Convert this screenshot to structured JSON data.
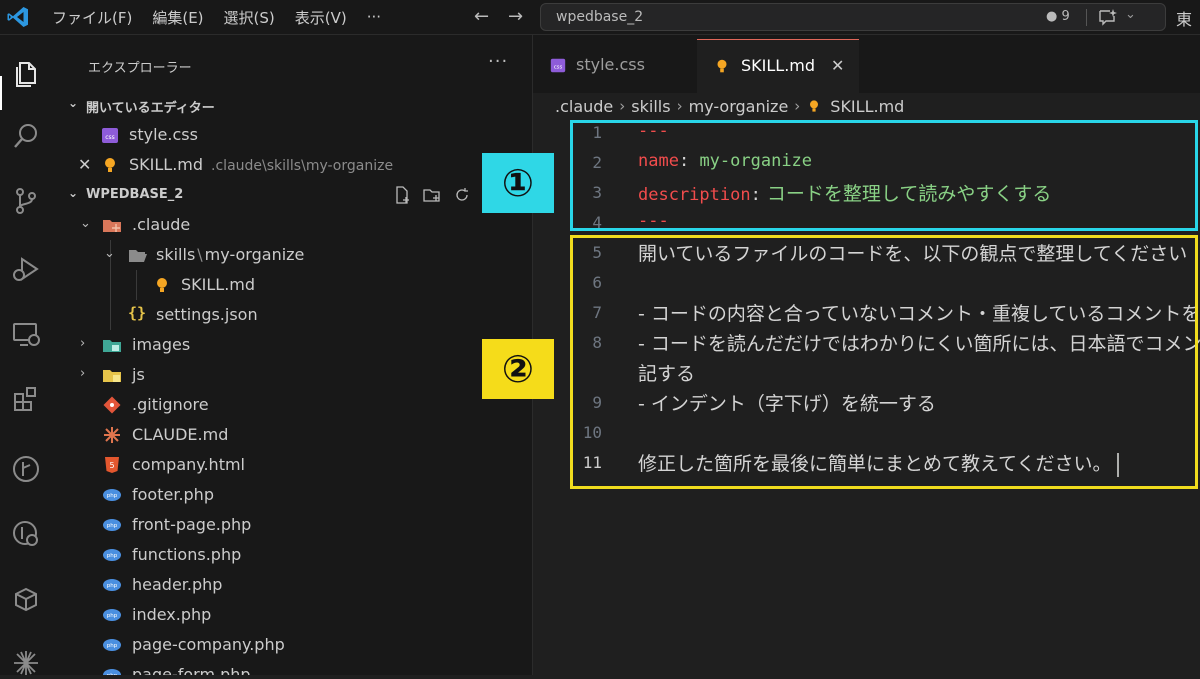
{
  "titlebar": {
    "menu": [
      "ファイル(F)",
      "編集(E)",
      "選択(S)",
      "表示(V)",
      "···"
    ],
    "search_text": "wpedbase_2",
    "change_count": "● 9",
    "clipped_text": "東"
  },
  "sidebar": {
    "header": "エクスプローラー",
    "more": "···",
    "open_editors": {
      "title": "開いているエディター",
      "items": [
        {
          "name": "style.css",
          "desc": ""
        },
        {
          "name": "SKILL.md",
          "desc": ".claude\\skills\\my-organize"
        }
      ]
    },
    "workspace": {
      "title": "WPEDBASE_2",
      "tree": [
        {
          "name": ".claude"
        },
        {
          "name": "skills",
          "sep": "\\",
          "name2": "my-organize"
        },
        {
          "name": "SKILL.md"
        },
        {
          "name": "settings.json"
        },
        {
          "name": "images"
        },
        {
          "name": "js"
        },
        {
          "name": ".gitignore"
        },
        {
          "name": "CLAUDE.md"
        },
        {
          "name": "company.html"
        },
        {
          "name": "footer.php"
        },
        {
          "name": "front-page.php"
        },
        {
          "name": "functions.php"
        },
        {
          "name": "header.php"
        },
        {
          "name": "index.php"
        },
        {
          "name": "page-company.php"
        },
        {
          "name": "page-form.php"
        }
      ]
    }
  },
  "editor": {
    "tabs": [
      {
        "label": "style.css"
      },
      {
        "label": "SKILL.md",
        "close": "✕"
      }
    ],
    "breadcrumb": [
      ".claude",
      "skills",
      "my-organize",
      "SKILL.md"
    ],
    "lines": [
      {
        "n": "1",
        "text": "---"
      },
      {
        "n": "2",
        "key": "name",
        "colon": ":",
        "value": " my-organize"
      },
      {
        "n": "3",
        "key": "description",
        "colon": ":",
        "value": " コードを整理して読みやすくする"
      },
      {
        "n": "4",
        "text": "---"
      },
      {
        "n": "5",
        "text": "開いているファイルのコードを、以下の観点で整理してください"
      },
      {
        "n": "6",
        "text": ""
      },
      {
        "n": "7",
        "text": "- コードの内容と合っていないコメント・重複しているコメントを削除する"
      },
      {
        "n": "8",
        "text": "- コードを読んだだけではわかりにくい箇所には、日本語でコメントを追"
      },
      {
        "n": "",
        "text": "記する"
      },
      {
        "n": "9",
        "text": "- インデント（字下げ）を統一する"
      },
      {
        "n": "10",
        "text": ""
      },
      {
        "n": "11",
        "text": "修正した箇所を最後に簡単にまとめて教えてください。"
      }
    ]
  },
  "annotations": {
    "badge1": "①",
    "badge2": "②",
    "box1_color": "#29d6e8",
    "box2_color": "#f0dc1e"
  },
  "colors": {
    "accent_tab": "#e0675a",
    "yaml_key": "#f14c4c",
    "yaml_value": "#89d185",
    "vscode_blue": "#2c97e0"
  }
}
